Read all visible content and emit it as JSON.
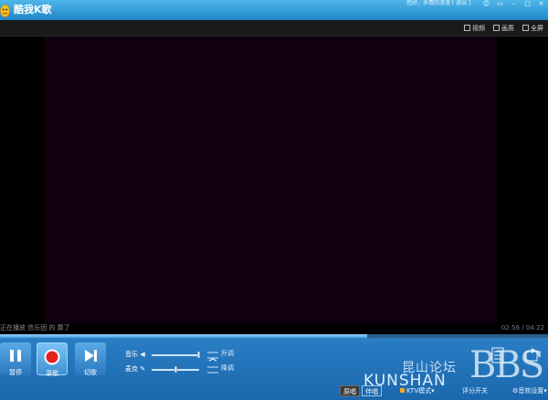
{
  "app": {
    "title": "酷我K歌",
    "user_text": "您好，多情的浪漫 [ 退出 ]"
  },
  "window_controls": {
    "skin_glyph": "☺",
    "mini_glyph": "▭",
    "minimize_glyph": "–",
    "maximize_glyph": "□",
    "close_glyph": "×"
  },
  "view_modes": {
    "video_label": "视频",
    "image_label": "画质",
    "fullscreen_label": "全屏"
  },
  "player": {
    "lyric_text": "正在播放 信乐团 的 算了",
    "time": "02:56 / 04:22",
    "progress_fraction": 0.67
  },
  "controls": {
    "pause_label": "暂停",
    "record_label": "录歌",
    "next_label": "切歌",
    "music_label": "音乐",
    "mic_label": "麦克",
    "raise_key_label": "升调",
    "lower_key_label": "降调",
    "music_volume_fraction": 1.0,
    "mic_volume_fraction": 0.52
  },
  "bottom": {
    "original_label": "原唱",
    "accompaniment_label": "伴唱",
    "mode_label": "KTV模式",
    "score_label": "评分开关",
    "settings_label": "音效设置"
  },
  "watermark": {
    "chinese": "昆山论坛",
    "english": "KUNSHAN",
    "big": "BBS"
  }
}
